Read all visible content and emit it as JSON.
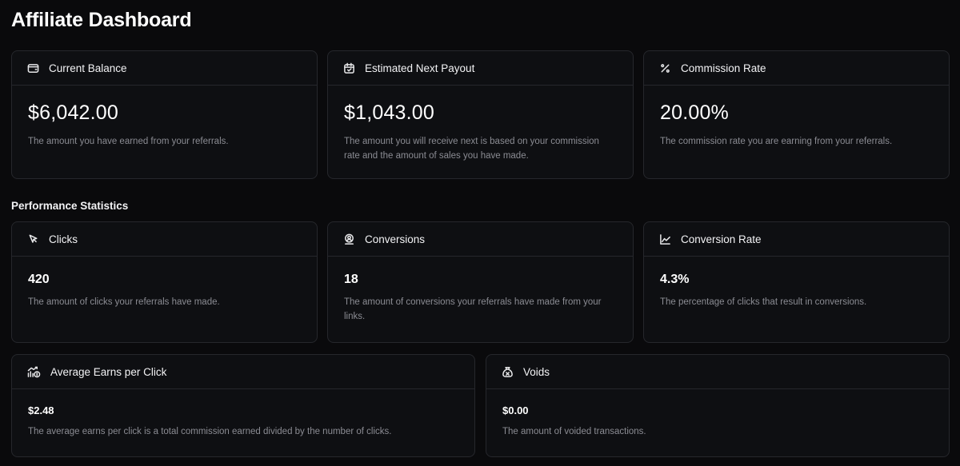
{
  "page": {
    "title": "Affiliate Dashboard"
  },
  "summary": [
    {
      "title": "Current Balance",
      "icon": "wallet-icon",
      "value": "$6,042.00",
      "description": "The amount you have earned from your referrals."
    },
    {
      "title": "Estimated Next Payout",
      "icon": "calendar-check-icon",
      "value": "$1,043.00",
      "description": "The amount you will receive next is based on your commission rate and the amount of sales you have made."
    },
    {
      "title": "Commission Rate",
      "icon": "percent-icon",
      "value": "20.00%",
      "description": "The commission rate you are earning from your referrals."
    }
  ],
  "performance": {
    "title": "Performance Statistics",
    "stats": [
      {
        "title": "Clicks",
        "icon": "cursor-icon",
        "value": "420",
        "description": "The amount of clicks your referrals have made."
      },
      {
        "title": "Conversions",
        "icon": "user-badge-icon",
        "value": "18",
        "description": "The amount of conversions your referrals have made from your links."
      },
      {
        "title": "Conversion Rate",
        "icon": "line-chart-icon",
        "value": "4.3%",
        "description": "The percentage of clicks that result in conversions."
      }
    ],
    "extra": [
      {
        "title": "Average Earns per Click",
        "icon": "chart-coins-icon",
        "value": "$2.48",
        "description": "The average earns per click is a total commission earned divided by the number of clicks."
      },
      {
        "title": "Voids",
        "icon": "money-bag-x-icon",
        "value": "$0.00",
        "description": "The amount of voided transactions."
      }
    ]
  }
}
